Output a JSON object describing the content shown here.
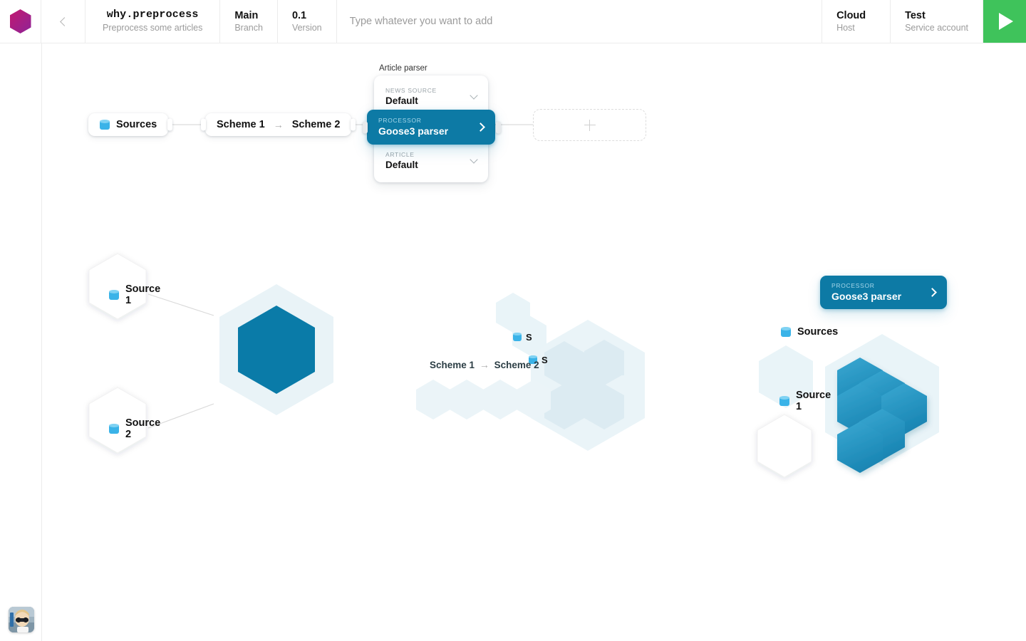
{
  "header": {
    "logo_icon": "hexagon-logo",
    "back_icon": "chevron-left-icon",
    "project": {
      "title": "why.preprocess",
      "subtitle": "Preprocess some articles"
    },
    "branch": {
      "title": "Main",
      "subtitle": "Branch"
    },
    "version": {
      "title": "0.1",
      "subtitle": "Version"
    },
    "add_input": {
      "value": "",
      "placeholder": "Type whatever you want to add"
    },
    "host": {
      "title": "Cloud",
      "subtitle": "Host"
    },
    "account": {
      "title": "Test",
      "subtitle": "Service account"
    },
    "run_icon": "play-icon",
    "run_color": "#3fc35b"
  },
  "flow": {
    "sources_node": {
      "label": "Sources",
      "icon": "database-icon"
    },
    "scheme_node": {
      "left": "Scheme 1",
      "arrow": "→",
      "right": "Scheme 2"
    },
    "parser_group": {
      "label": "Article parser",
      "fields": [
        {
          "label": "NEWS SOURCE",
          "value": "Default",
          "control": "chevron-down-icon",
          "selected": false
        },
        {
          "label": "PROCESSOR",
          "value": "Goose3 parser",
          "control": "chevron-right-icon",
          "selected": true
        },
        {
          "label": "ARTICLE",
          "value": "Default",
          "control": "chevron-down-icon",
          "selected": false
        }
      ]
    },
    "add_slot": {
      "icon": "plus-icon"
    }
  },
  "illustrations": {
    "left": {
      "sources": [
        {
          "label": "Source 1",
          "icon": "database-icon"
        },
        {
          "label": "Source 2",
          "icon": "database-icon"
        }
      ],
      "hex_color": "#0a7ba8"
    },
    "middle": {
      "mini_nodes": [
        {
          "label": "S",
          "icon": "database-icon"
        },
        {
          "label": "S",
          "icon": "database-icon"
        }
      ],
      "scheme": {
        "left": "Scheme 1",
        "arrow": "→",
        "right": "Scheme 2"
      }
    },
    "right": {
      "processor_chip": {
        "label": "PROCESSOR",
        "value": "Goose3 parser",
        "control": "chevron-right-icon"
      },
      "nodes": [
        {
          "label": "Sources",
          "icon": "database-icon"
        },
        {
          "label": "Source 1",
          "icon": "database-icon"
        }
      ],
      "hex_color": "#2e9cc8"
    }
  },
  "user": {
    "avatar_icon": "user-avatar"
  },
  "colors": {
    "accent_teal": "#0d7aa5",
    "deep_teal": "#0a7ba8",
    "run_green": "#3fc35b",
    "logo_magenta": "#b51f7c",
    "db_icon_blue": "#3ab3e8",
    "ghost_tint": "#e8f3f7"
  }
}
